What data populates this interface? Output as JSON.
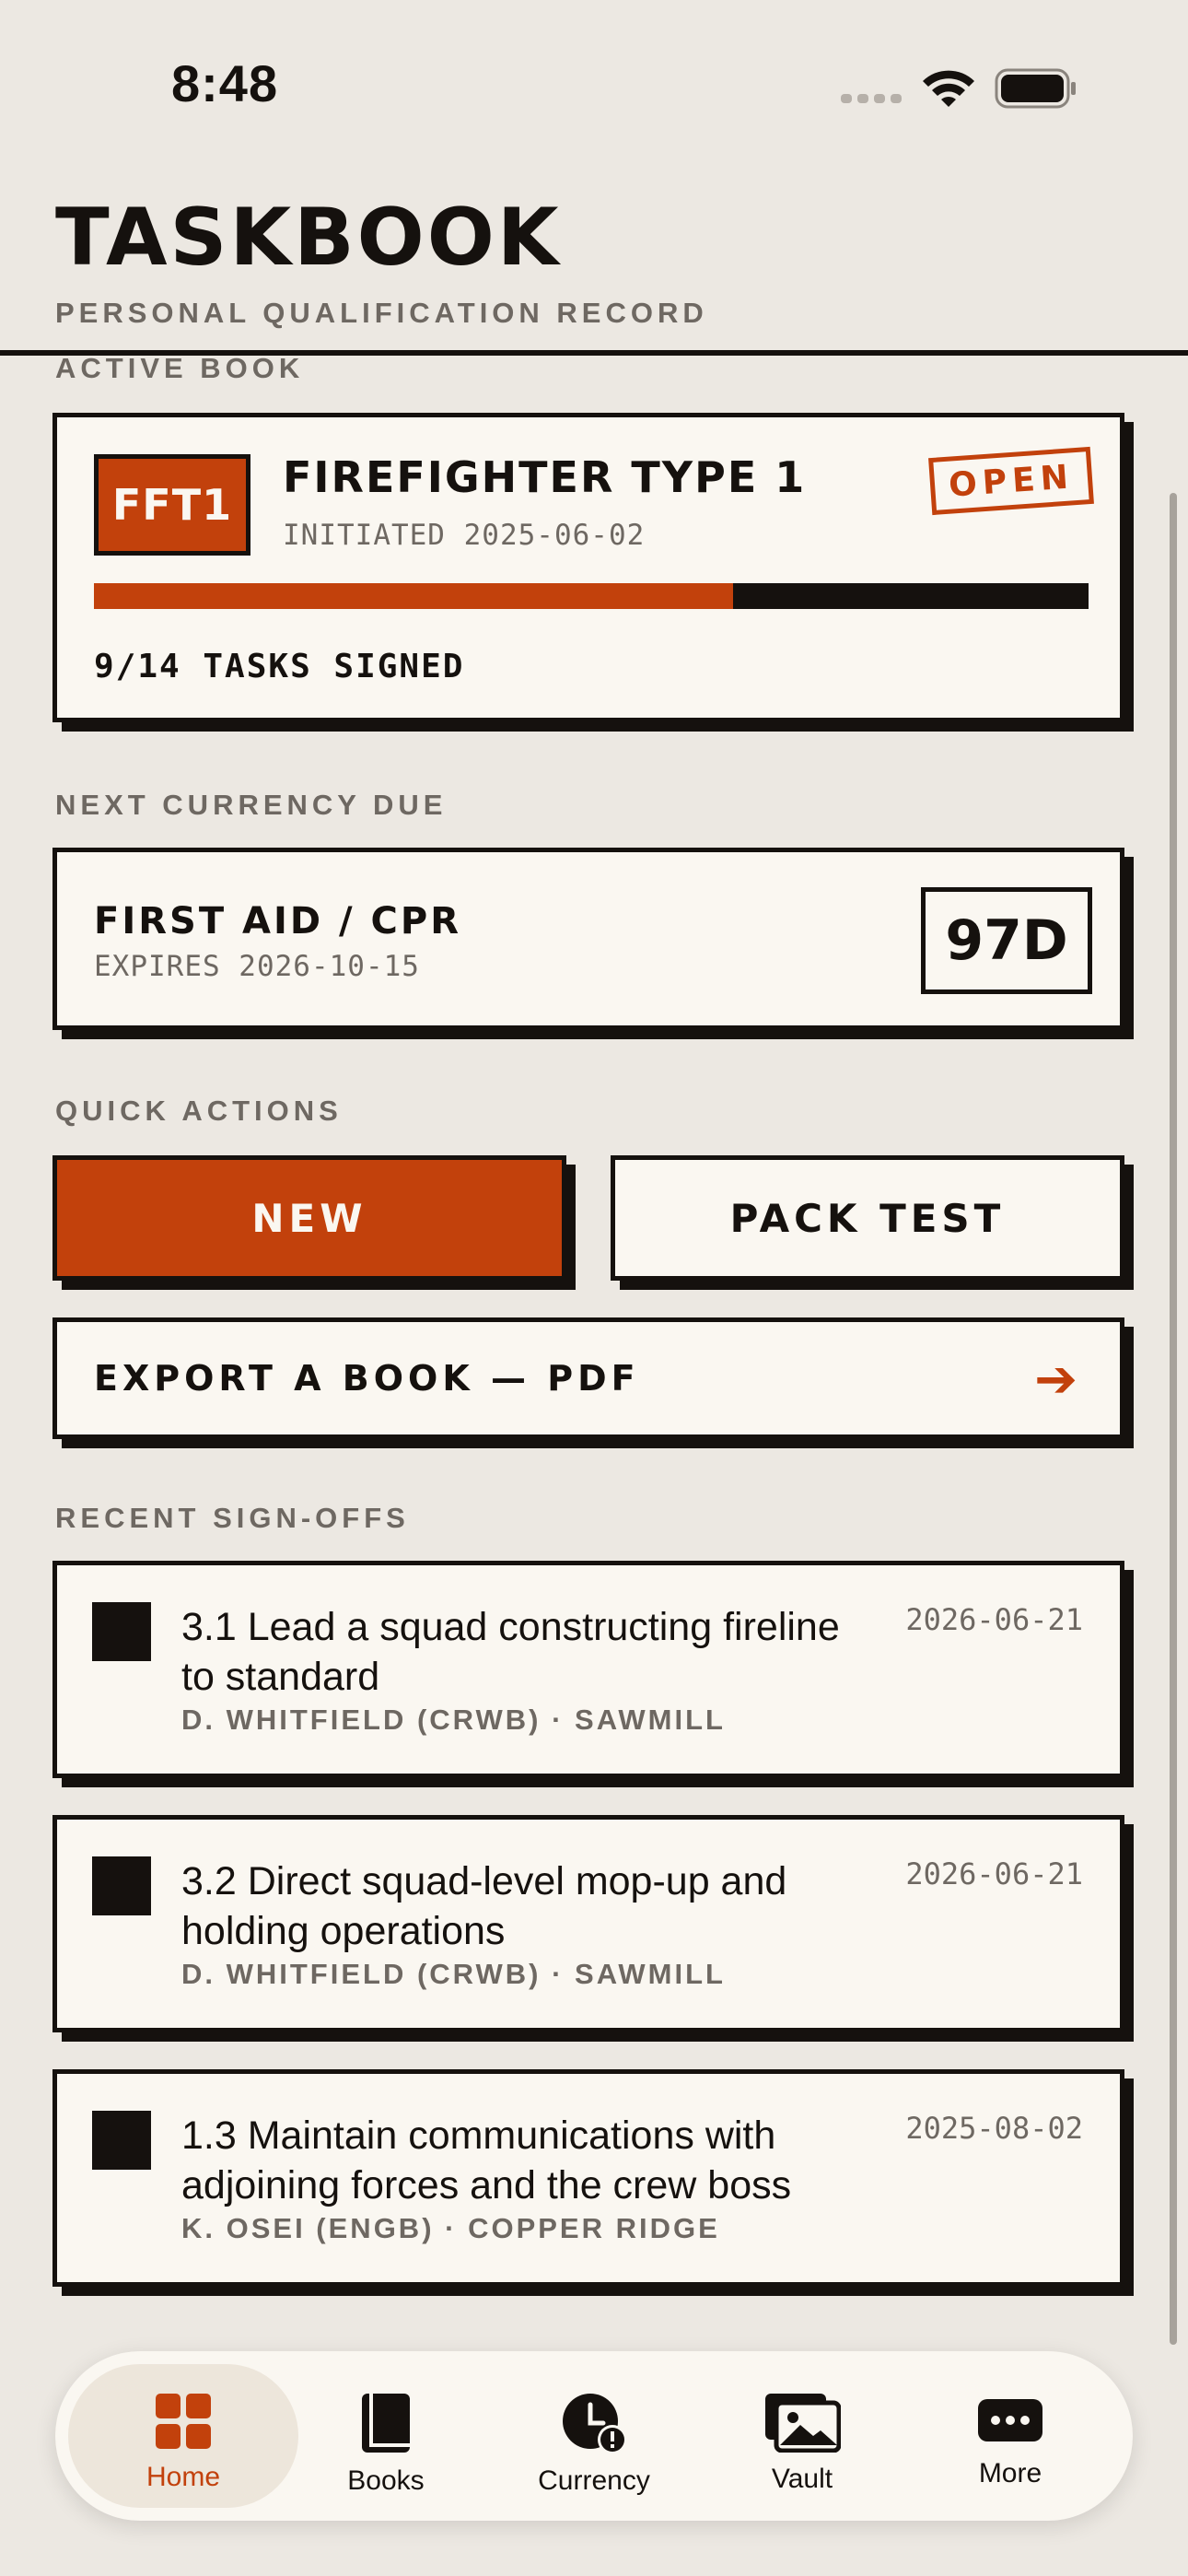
{
  "status_bar": {
    "time": "8:48"
  },
  "header": {
    "title": "TASKBOOK",
    "subtitle": "PERSONAL QUALIFICATION RECORD"
  },
  "active_book": {
    "section_label": "ACTIVE BOOK",
    "badge": "FFT1",
    "name": "FIREFIGHTER TYPE 1",
    "initiated": "INITIATED 2025-06-02",
    "status_stamp": "OPEN",
    "progress_fraction": 0.643,
    "tasks_signed": "9/14 TASKS SIGNED",
    "accent_color": "#C2410C"
  },
  "currency": {
    "section_label": "NEXT CURRENCY DUE",
    "name": "FIRST AID / CPR",
    "expires": "EXPIRES 2026-10-15",
    "days_left": "97D"
  },
  "quick_actions": {
    "section_label": "QUICK ACTIONS",
    "new_label": "NEW",
    "pack_test_label": "PACK TEST",
    "export_label": "EXPORT A BOOK — PDF",
    "export_icon": "arrow-right-icon"
  },
  "recent": {
    "section_label": "RECENT SIGN-OFFS",
    "items": [
      {
        "title": "3.1  Lead a squad constructing fireline to standard",
        "by": "D. WHITFIELD (CRWB) · SAWMILL",
        "date": "2026-06-21"
      },
      {
        "title": "3.2  Direct squad-level mop-up and holding operations",
        "by": "D. WHITFIELD (CRWB) · SAWMILL",
        "date": "2026-06-21"
      },
      {
        "title": "1.3  Maintain communications with adjoining forces and the crew boss",
        "by": "K. OSEI (ENGB) · COPPER RIDGE",
        "date": "2025-08-02"
      }
    ]
  },
  "tab_bar": {
    "tabs": [
      {
        "label": "Home",
        "icon": "home-grid-icon",
        "active": true
      },
      {
        "label": "Books",
        "icon": "book-icon",
        "active": false
      },
      {
        "label": "Currency",
        "icon": "clock-alert-icon",
        "active": false
      },
      {
        "label": "Vault",
        "icon": "photos-icon",
        "active": false
      },
      {
        "label": "More",
        "icon": "more-icon",
        "active": false
      }
    ]
  }
}
